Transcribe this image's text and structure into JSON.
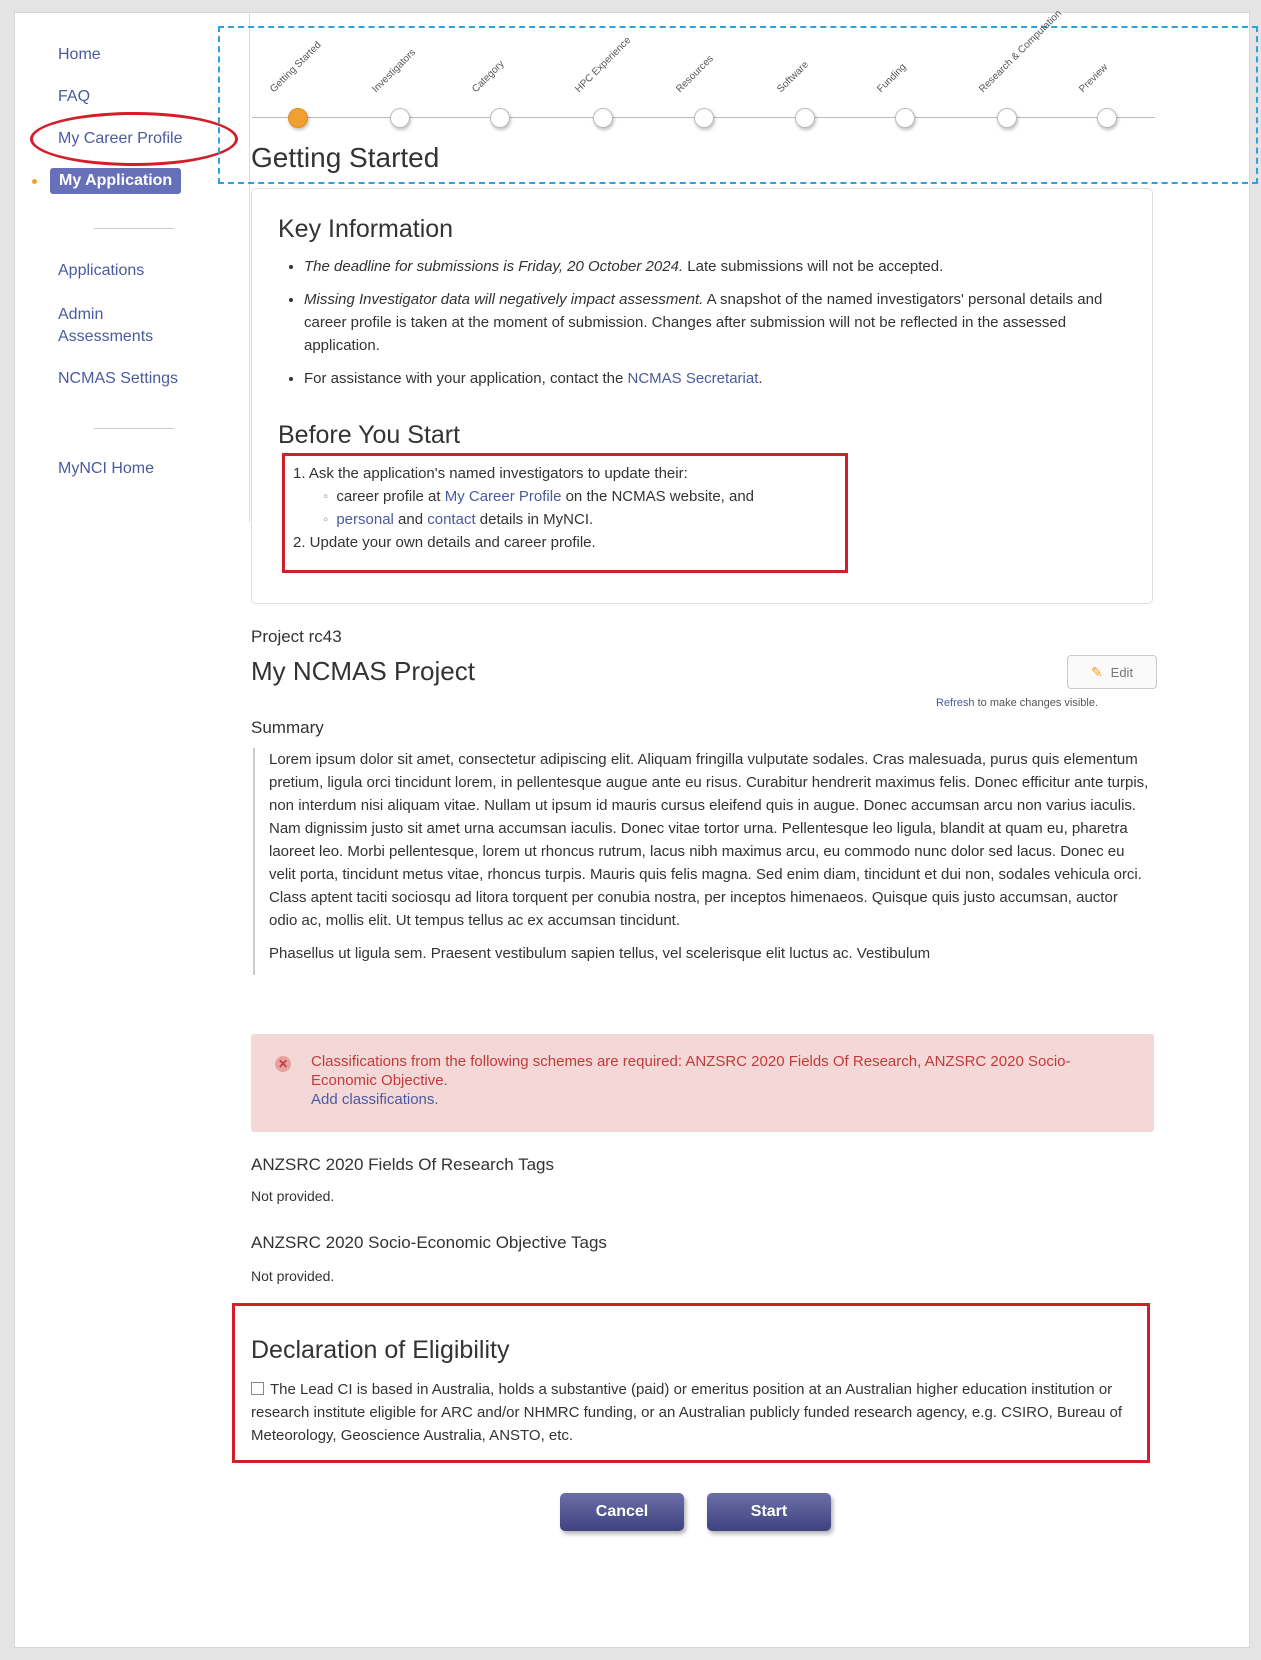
{
  "nav": {
    "home": "Home",
    "faq": "FAQ",
    "career_profile": "My Career Profile",
    "my_application": "My Application",
    "applications": "Applications",
    "admin_assessments_1": "Admin",
    "admin_assessments_2": "Assessments",
    "ncmas_settings": "NCMAS Settings",
    "mynci_home": "MyNCI Home"
  },
  "steps": [
    "Getting Started",
    "Investigators",
    "Category",
    "HPC Experience",
    "Resources",
    "Software",
    "Funding",
    "Research & Computation",
    "Preview"
  ],
  "page_title": "Getting Started",
  "key_info": {
    "heading": "Key Information",
    "item1_em": "The deadline for submissions is Friday, 20 October 2024.",
    "item1_rest": " Late submissions will not be accepted.",
    "item2_em": "Missing Investigator data will negatively impact assessment.",
    "item2_rest": " A snapshot of the named investigators' personal details and career profile is taken at the moment of submission. Changes after submission will not be reflected in the assessed application.",
    "item3_pre": "For assistance with your application, contact the ",
    "item3_link": "NCMAS Secretariat",
    "item3_post": "."
  },
  "before_start": {
    "heading": "Before You Start",
    "step1": "1. Ask the application's named investigators to update their:",
    "sub1_pre": "career profile at ",
    "sub1_link": "My Career Profile",
    "sub1_post": " on the NCMAS website, and",
    "sub2_link1": "personal",
    "sub2_mid": " and ",
    "sub2_link2": "contact",
    "sub2_post": " details in MyNCI.",
    "step2": "2. Update your own details and career profile."
  },
  "project": {
    "id": "Project rc43",
    "name": "My NCMAS Project",
    "edit_label": "Edit",
    "refresh_link": "Refresh",
    "refresh_rest": " to make changes visible.",
    "summary_heading": "Summary",
    "summary_p1": "Lorem ipsum dolor sit amet, consectetur adipiscing elit. Aliquam fringilla vulputate sodales. Cras malesuada, purus quis elementum pretium, ligula orci tincidunt lorem, in pellentesque augue ante eu risus. Curabitur hendrerit maximus felis. Donec efficitur ante turpis, non interdum nisi aliquam vitae. Nullam ut ipsum id mauris cursus eleifend quis in augue. Donec accumsan arcu non varius iaculis. Nam dignissim justo sit amet urna accumsan iaculis. Donec vitae tortor urna. Pellentesque leo ligula, blandit at quam eu, pharetra laoreet leo. Morbi pellentesque, lorem ut rhoncus rutrum, lacus nibh maximus arcu, eu commodo nunc dolor sed lacus. Donec eu velit porta, tincidunt metus vitae, rhoncus turpis. Mauris quis felis magna. Sed enim diam, tincidunt et dui non, sodales vehicula orci. Class aptent taciti sociosqu ad litora torquent per conubia nostra, per inceptos himenaeos. Quisque quis justo accumsan, auctor odio ac, mollis elit. Ut tempus tellus ac ex accumsan tincidunt.",
    "summary_p2": "Phasellus ut ligula sem. Praesent vestibulum sapien tellus, vel scelerisque elit luctus ac. Vestibulum"
  },
  "alert": {
    "message": "Classifications from the following schemes are required: ANZSRC 2020 Fields Of Research, ANZSRC 2020 Socio-Economic Objective.",
    "link": "Add classifications."
  },
  "tags": {
    "for_heading": "ANZSRC 2020 Fields Of Research Tags",
    "for_value": "Not provided.",
    "seo_heading": "ANZSRC 2020 Socio-Economic Objective Tags",
    "seo_value": "Not provided."
  },
  "declaration": {
    "heading": "Declaration of Eligibility",
    "text": "The Lead CI is based in Australia, holds a substantive (paid) or emeritus position at an Australian higher education institution or research institute eligible for ARC and/or NHMRC funding, or an Australian publicly funded research agency, e.g. CSIRO, Bureau of Meteorology, Geoscience Australia, ANSTO, etc."
  },
  "buttons": {
    "cancel": "Cancel",
    "start": "Start"
  },
  "colors": {
    "accent": "#6670b8",
    "link": "#4a5aa0",
    "annotation_red": "#d21f2a",
    "annotation_blue": "#2ba3e0",
    "error_text": "#c23a3a",
    "error_bg": "#f4d8d8",
    "current_step": "#f0a030"
  }
}
